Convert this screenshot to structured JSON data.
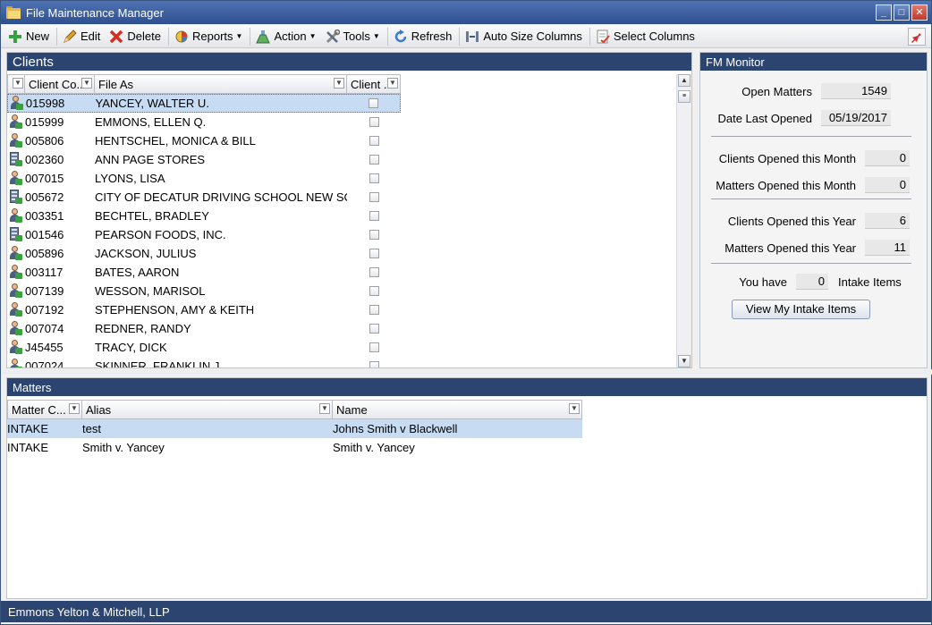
{
  "window": {
    "title": "File Maintenance Manager",
    "controls": [
      "minimize",
      "maximize",
      "close"
    ]
  },
  "toolbar": {
    "new_label": "New",
    "edit_label": "Edit",
    "delete_label": "Delete",
    "reports_label": "Reports",
    "action_label": "Action",
    "tools_label": "Tools",
    "refresh_label": "Refresh",
    "autosize_label": "Auto Size Columns",
    "selectcols_label": "Select Columns"
  },
  "clients": {
    "header": "Clients",
    "columns": {
      "code": "Client Co...",
      "fileas": "File As",
      "client": "Client ..."
    },
    "rows": [
      {
        "type": "person",
        "code": "015998",
        "fileas": "YANCEY, WALTER U.",
        "selected": true
      },
      {
        "type": "person",
        "code": "015999",
        "fileas": "EMMONS, ELLEN Q."
      },
      {
        "type": "person",
        "code": "005806",
        "fileas": "HENTSCHEL, MONICA & BILL"
      },
      {
        "type": "building",
        "code": "002360",
        "fileas": "ANN PAGE STORES"
      },
      {
        "type": "person",
        "code": "007015",
        "fileas": "LYONS, LISA"
      },
      {
        "type": "building",
        "code": "005672",
        "fileas": "CITY OF DECATUR DRIVING SCHOOL NEW SC..."
      },
      {
        "type": "person",
        "code": "003351",
        "fileas": "BECHTEL, BRADLEY"
      },
      {
        "type": "building",
        "code": "001546",
        "fileas": "PEARSON FOODS, INC."
      },
      {
        "type": "person",
        "code": "005896",
        "fileas": "JACKSON, JULIUS"
      },
      {
        "type": "person",
        "code": "003117",
        "fileas": "BATES, AARON"
      },
      {
        "type": "person",
        "code": "007139",
        "fileas": "WESSON, MARISOL"
      },
      {
        "type": "person",
        "code": "007192",
        "fileas": "STEPHENSON, AMY & KEITH"
      },
      {
        "type": "person",
        "code": "007074",
        "fileas": "REDNER, RANDY"
      },
      {
        "type": "person",
        "code": "J45455",
        "fileas": "TRACY, DICK"
      },
      {
        "type": "person",
        "code": "007024",
        "fileas": "SKINNER, FRANKLIN J."
      }
    ]
  },
  "monitor": {
    "header": "FM Monitor",
    "open_matters_label": "Open Matters",
    "open_matters_value": "1549",
    "date_last_opened_label": "Date Last Opened",
    "date_last_opened_value": "05/19/2017",
    "clients_month_label": "Clients Opened this Month",
    "clients_month_value": "0",
    "matters_month_label": "Matters Opened this Month",
    "matters_month_value": "0",
    "clients_year_label": "Clients Opened this Year",
    "clients_year_value": "6",
    "matters_year_label": "Matters Opened this Year",
    "matters_year_value": "11",
    "you_have_label": "You have",
    "intake_count": "0",
    "intake_items_label": "Intake Items",
    "view_intake_button": "View My Intake Items"
  },
  "matters": {
    "header": "Matters",
    "columns": {
      "matter": "Matter C...",
      "alias": "Alias",
      "name": "Name"
    },
    "rows": [
      {
        "matter": "INTAKE",
        "alias": "test",
        "name": "Johns Smith v Blackwell",
        "selected": true
      },
      {
        "matter": "INTAKE",
        "alias": "Smith v. Yancey",
        "name": "Smith v. Yancey"
      }
    ]
  },
  "status": {
    "firm_name": "Emmons Yelton & Mitchell, LLP"
  }
}
